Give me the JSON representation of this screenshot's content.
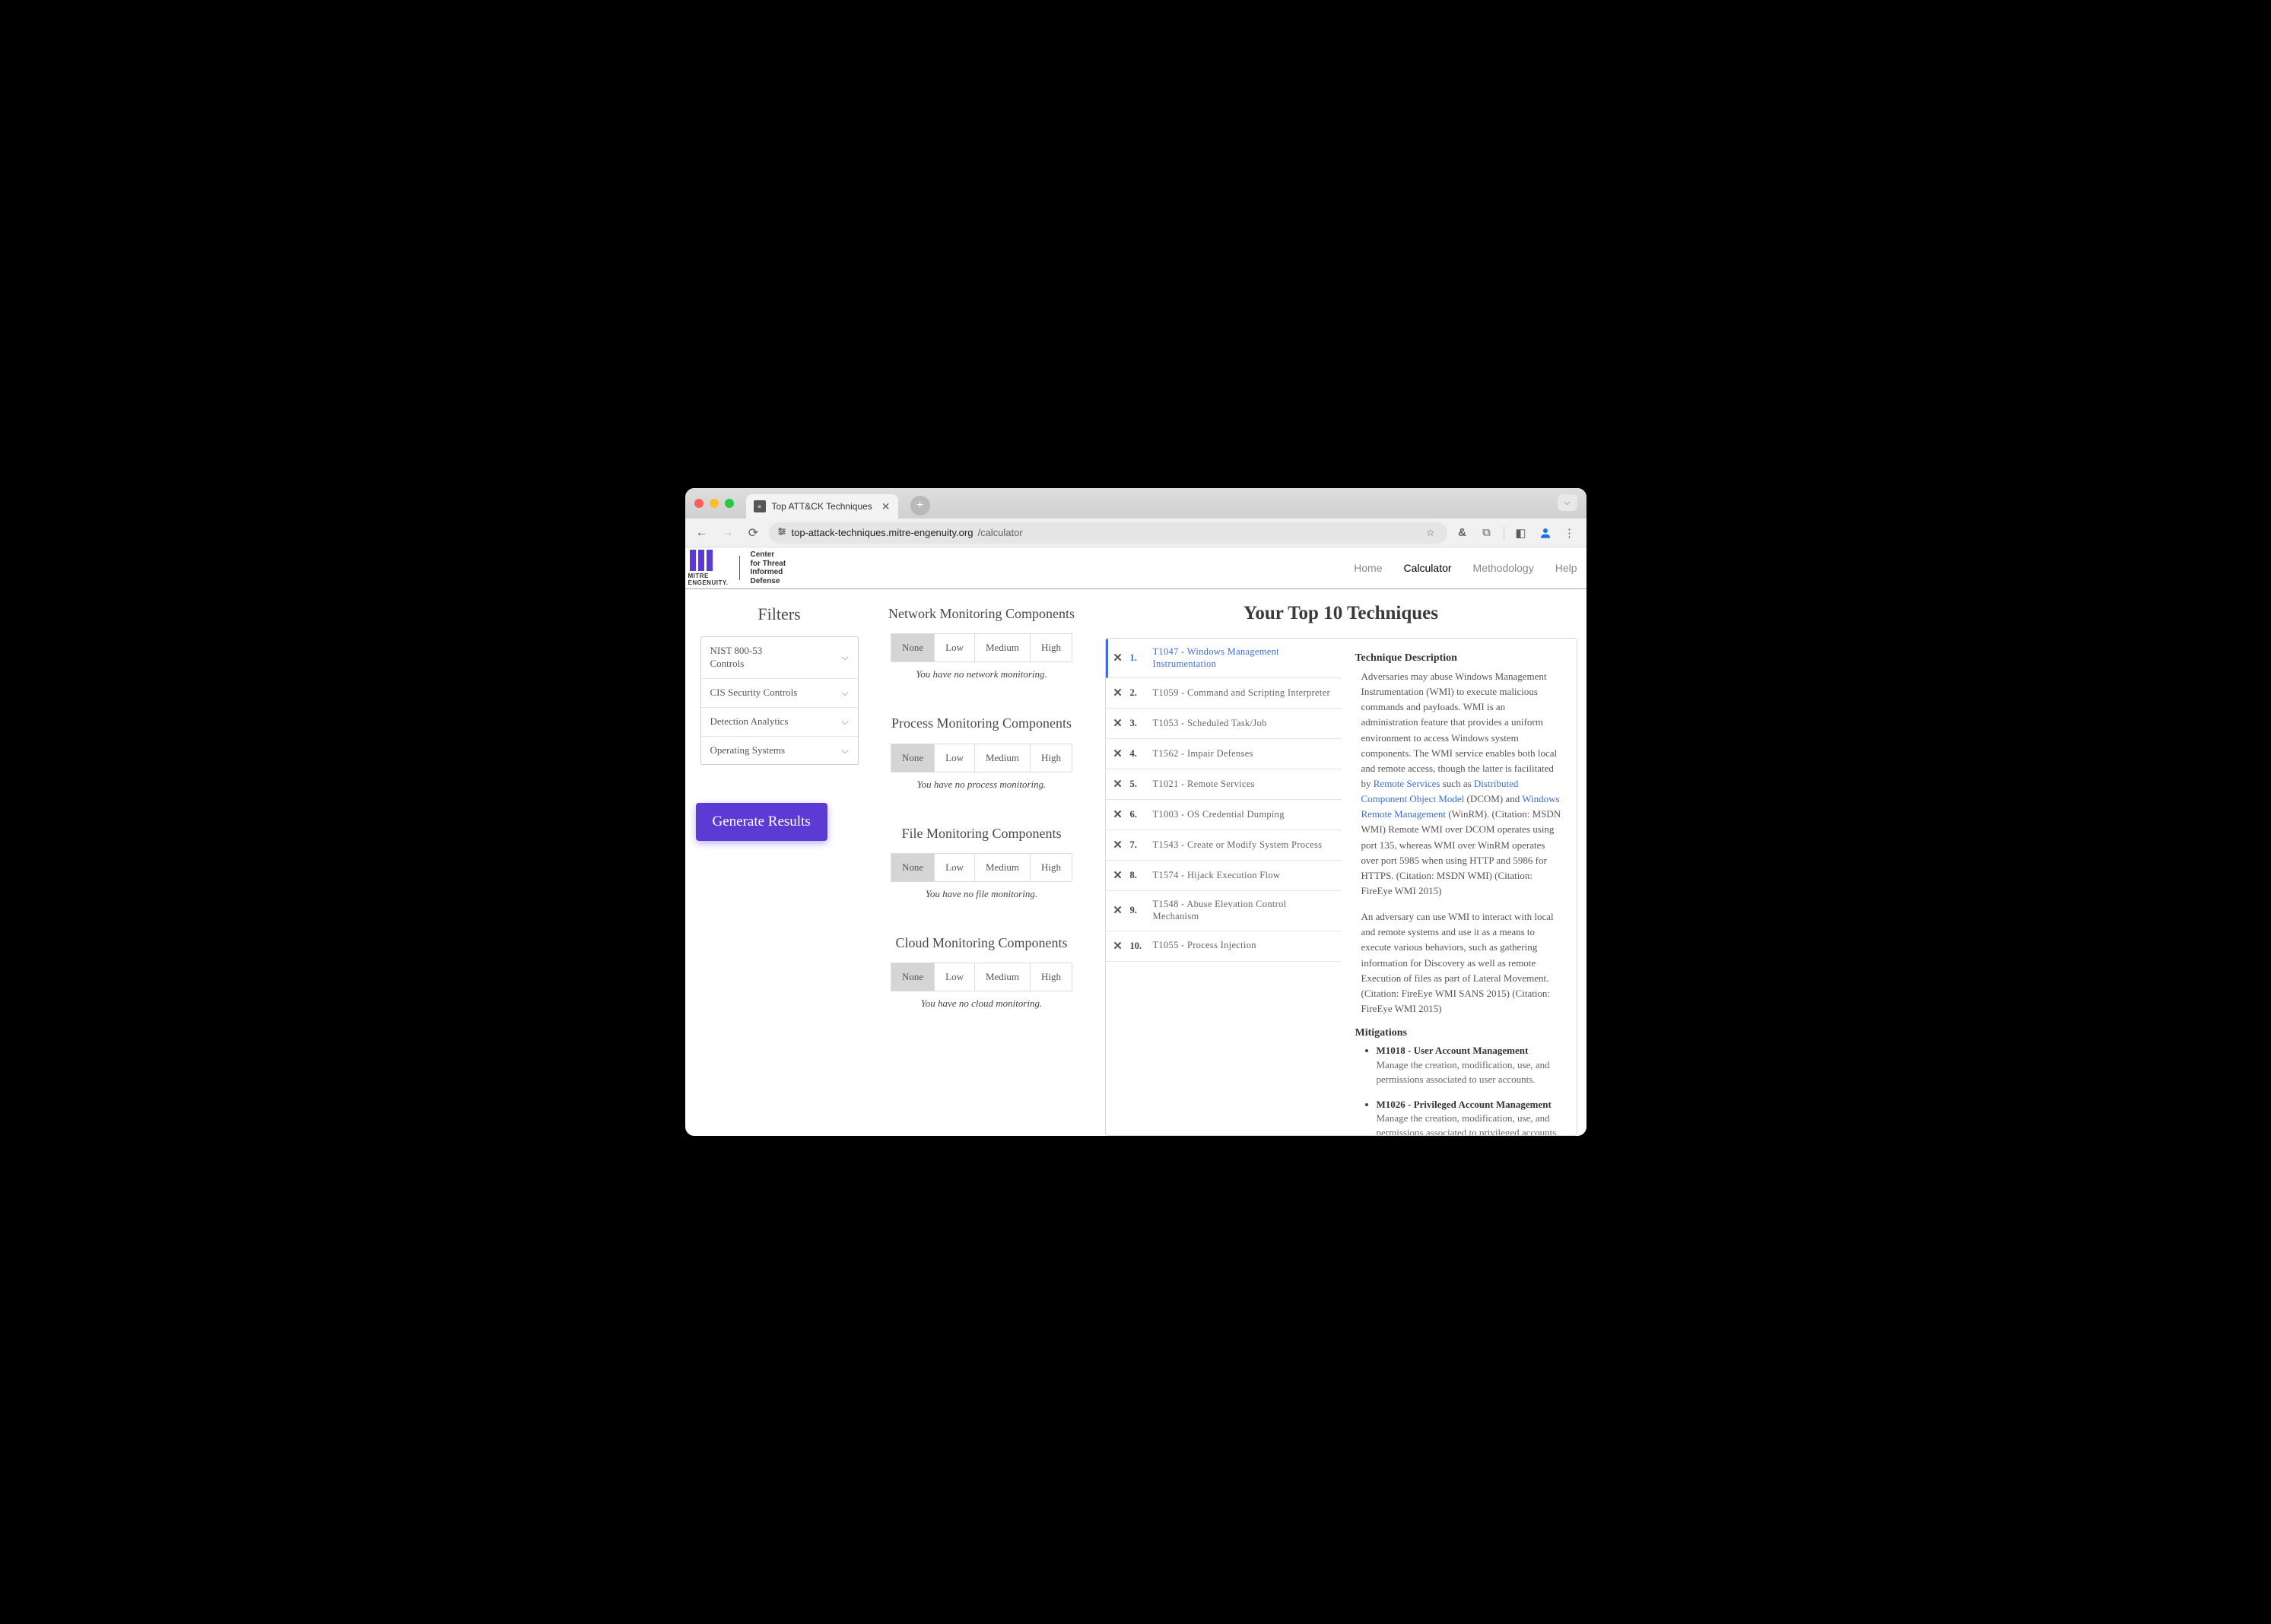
{
  "browser": {
    "tab_title": "Top ATT&CK Techniques",
    "url_domain": "top-attack-techniques.mitre-engenuity.org",
    "url_path": "/calculator"
  },
  "header": {
    "logo_line1": "MITRE",
    "logo_line2": "ENGENUITY.",
    "sub_line1": "Center",
    "sub_line2": "for Threat",
    "sub_line3": "Informed",
    "sub_line4": "Defense",
    "nav": [
      {
        "label": "Home",
        "active": false
      },
      {
        "label": "Calculator",
        "active": true
      },
      {
        "label": "Methodology",
        "active": false
      },
      {
        "label": "Help",
        "active": false
      }
    ]
  },
  "filters": {
    "title": "Filters",
    "items": [
      {
        "label": "NIST 800-53 Controls"
      },
      {
        "label": "CIS Security Controls"
      },
      {
        "label": "Detection Analytics"
      },
      {
        "label": "Operating Systems"
      }
    ],
    "generate_label": "Generate Results"
  },
  "components": {
    "levels": [
      "None",
      "Low",
      "Medium",
      "High"
    ],
    "sections": [
      {
        "title": "Network Monitoring Components",
        "selected": "None",
        "caption": "You have no network monitoring."
      },
      {
        "title": "Process Monitoring Components",
        "selected": "None",
        "caption": "You have no process monitoring."
      },
      {
        "title": "File Monitoring Components",
        "selected": "None",
        "caption": "You have no file monitoring."
      },
      {
        "title": "Cloud Monitoring Components",
        "selected": "None",
        "caption": "You have no cloud monitoring."
      }
    ]
  },
  "techniques": {
    "title": "Your Top 10 Techniques",
    "list": [
      {
        "rank": "1.",
        "name": "T1047 - Windows Management Instrumentation",
        "selected": true
      },
      {
        "rank": "2.",
        "name": "T1059 - Command and Scripting Interpreter",
        "selected": false
      },
      {
        "rank": "3.",
        "name": "T1053 - Scheduled Task/Job",
        "selected": false
      },
      {
        "rank": "4.",
        "name": "T1562 - Impair Defenses",
        "selected": false
      },
      {
        "rank": "5.",
        "name": "T1021 - Remote Services",
        "selected": false
      },
      {
        "rank": "6.",
        "name": "T1003 - OS Credential Dumping",
        "selected": false
      },
      {
        "rank": "7.",
        "name": "T1543 - Create or Modify System Process",
        "selected": false
      },
      {
        "rank": "8.",
        "name": "T1574 - Hijack Execution Flow",
        "selected": false
      },
      {
        "rank": "9.",
        "name": "T1548 - Abuse Elevation Control Mechanism",
        "selected": false
      },
      {
        "rank": "10.",
        "name": "T1055 - Process Injection",
        "selected": false
      }
    ]
  },
  "detail": {
    "heading": "Technique Description",
    "p1_pre": "Adversaries may abuse Windows Management Instrumentation (WMI) to execute malicious commands and payloads. WMI is an administration feature that provides a uniform environment to access Windows system components. The WMI service enables both local and remote access, though the latter is facilitated by ",
    "link1": "Remote Services",
    "p1_mid1": " such as ",
    "link2": "Distributed Component Object Model",
    "p1_mid2": " (DCOM) and ",
    "link3": "Windows Remote Management",
    "p1_post": " (WinRM). (Citation: MSDN WMI) Remote WMI over DCOM operates using port 135, whereas WMI over WinRM operates over port 5985 when using HTTP and 5986 for HTTPS. (Citation: MSDN WMI) (Citation: FireEye WMI 2015)",
    "p2": "An adversary can use WMI to interact with local and remote systems and use it as a means to execute various behaviors, such as gathering information for Discovery as well as remote Execution of files as part of Lateral Movement. (Citation: FireEye WMI SANS 2015) (Citation: FireEye WMI 2015)",
    "mitigations_heading": "Mitigations",
    "mitigations": [
      {
        "head": "M1018 - User Account Management",
        "body": "Manage the creation, modification, use, and permissions associated to user accounts."
      },
      {
        "head": "M1026 - Privileged Account Management",
        "body": "Manage the creation, modification, use, and permissions associated to privileged accounts,"
      }
    ]
  }
}
